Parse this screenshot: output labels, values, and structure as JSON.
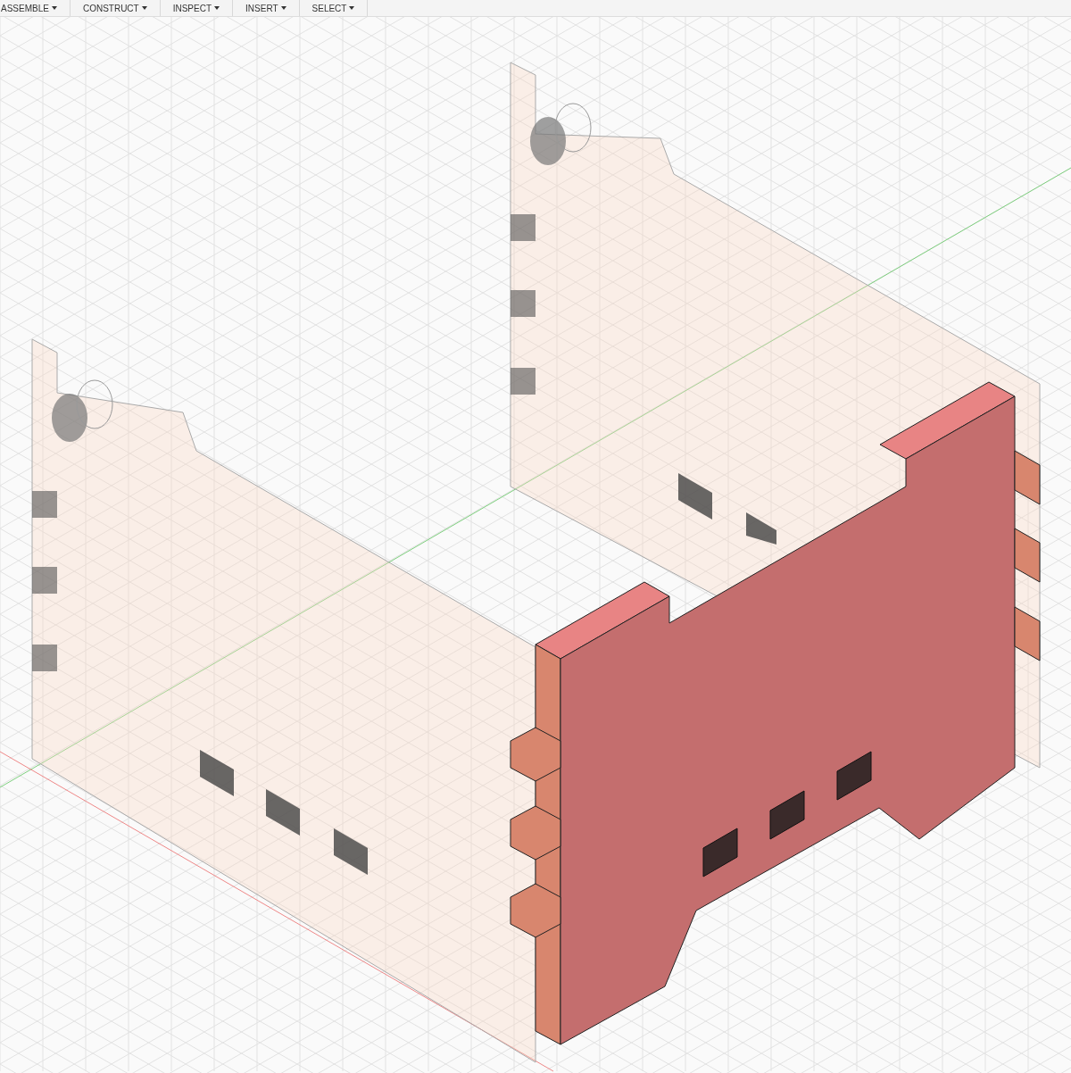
{
  "toolbar": {
    "menus": [
      {
        "label": "ASSEMBLE"
      },
      {
        "label": "CONSTRUCT"
      },
      {
        "label": "INSPECT"
      },
      {
        "label": "INSERT"
      },
      {
        "label": "SELECT"
      }
    ]
  }
}
